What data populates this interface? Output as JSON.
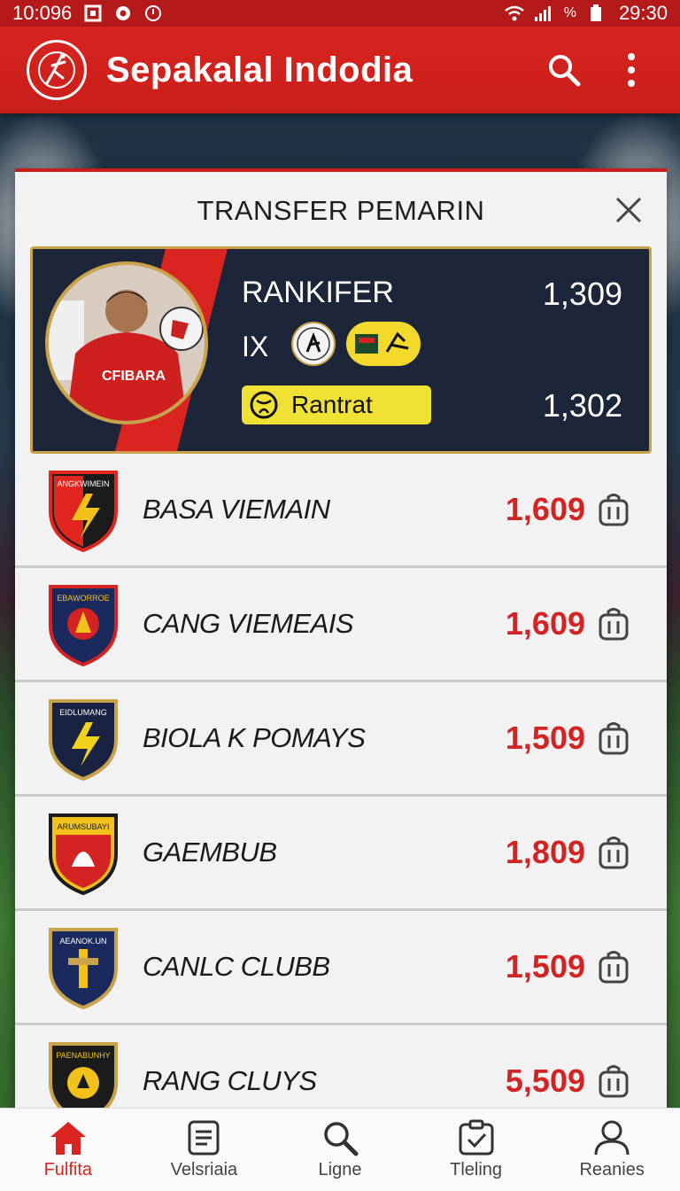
{
  "status_bar": {
    "time_left": "10:096",
    "time_right": "29:30",
    "battery_text": "%"
  },
  "app_bar": {
    "title": "Sepakalal Indodia",
    "icons": [
      "app-logo-icon",
      "search-icon",
      "more-vert-icon"
    ]
  },
  "panel": {
    "title": "TRANSFER PEMARIN",
    "featured": {
      "player_name": "RANKIFER",
      "jersey_text": "CFIBARA",
      "value_top": "1,309",
      "code": "IX",
      "button_label": "Rantrat",
      "value_bottom": "1,302"
    },
    "clubs": [
      {
        "name": "BASA VIEMAIN",
        "price": "1,609",
        "crest_text": "ANGKWIMEIN",
        "crest_colors": [
          "#e0261f",
          "#1b1b1b",
          "#f2c21b"
        ]
      },
      {
        "name": "CANG VIEMEAIS",
        "price": "1,609",
        "crest_text": "EBAWORROE",
        "crest_colors": [
          "#1b2a5e",
          "#d42323",
          "#f2c21b"
        ]
      },
      {
        "name": "BIOLA K POMAYS",
        "price": "1,509",
        "crest_text": "EIDLUMANG",
        "crest_colors": [
          "#1a2244",
          "#f2d21b",
          "#c9a24a"
        ]
      },
      {
        "name": "GAEMBUB",
        "price": "1,809",
        "crest_text": "ARUMSUBAYI",
        "crest_colors": [
          "#d42323",
          "#1b1b1b",
          "#f2c21b"
        ]
      },
      {
        "name": "CANLC CLUBB",
        "price": "1,509",
        "crest_text": "AEANOK.UN",
        "crest_colors": [
          "#1b2a5e",
          "#c9a24a",
          "#f2c21b"
        ]
      },
      {
        "name": "RANG CLUYS",
        "price": "5,509",
        "crest_text": "PAENABUNHY",
        "crest_colors": [
          "#1b1b1b",
          "#c9a24a",
          "#f2c21b"
        ]
      }
    ]
  },
  "bottom_nav": {
    "items": [
      {
        "label": "Fulfita",
        "icon": "home-icon",
        "active": true
      },
      {
        "label": "Velsriaia",
        "icon": "document-icon",
        "active": false
      },
      {
        "label": "Ligne",
        "icon": "search-icon",
        "active": false
      },
      {
        "label": "Tleling",
        "icon": "clipboard-check-icon",
        "active": false
      },
      {
        "label": "Reanies",
        "icon": "profile-icon",
        "active": false
      }
    ]
  },
  "colors": {
    "brand_red": "#d9241f",
    "price_red": "#d42323",
    "card_navy": "#1c2638",
    "gold": "#c9a24a",
    "yellow": "#f0e234"
  }
}
